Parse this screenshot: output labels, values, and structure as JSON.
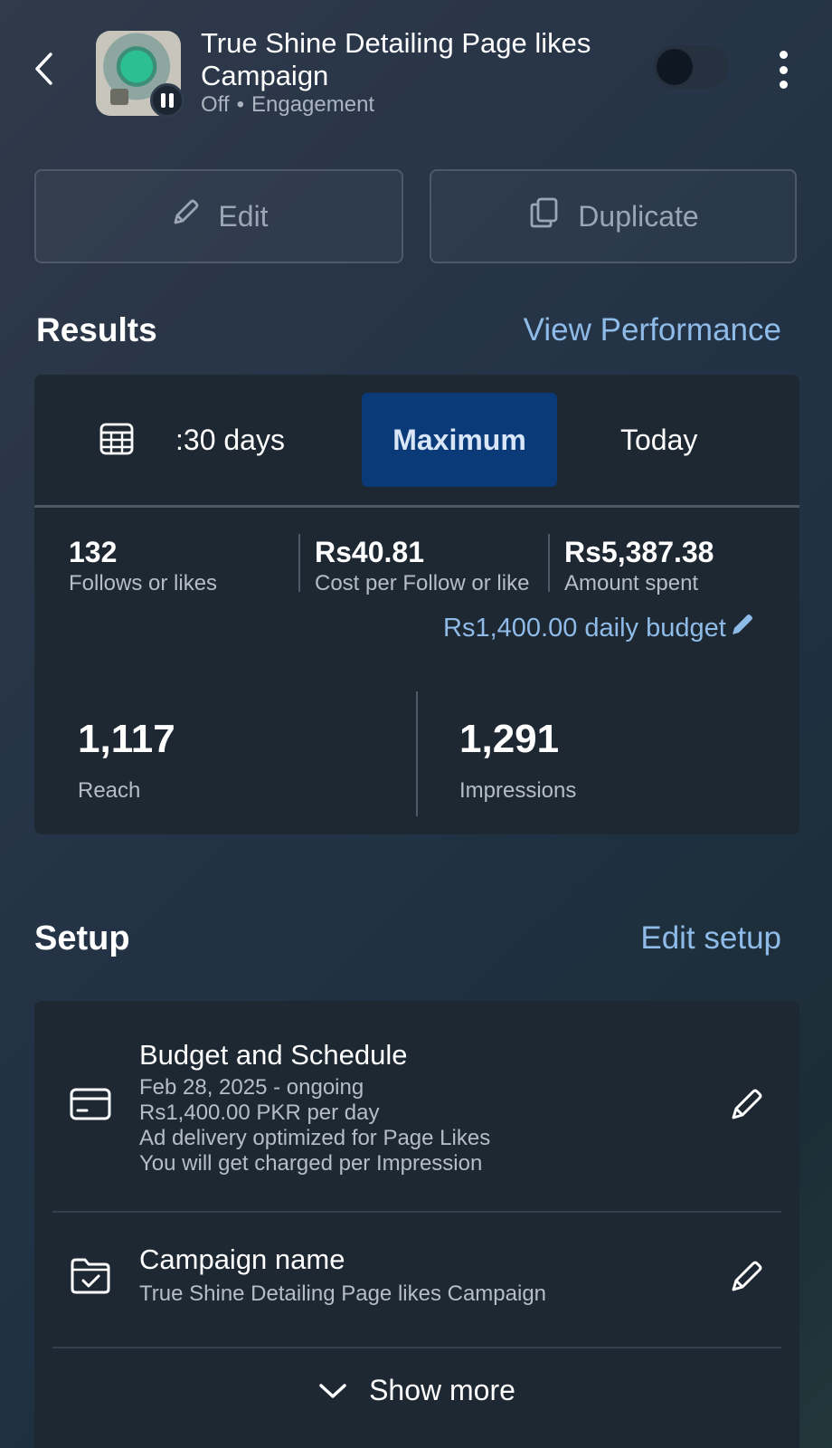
{
  "header": {
    "title": "True Shine Detailing Page likes Campaign",
    "status": "Off",
    "separator": "•",
    "objective": "Engagement",
    "toggle_on": false
  },
  "actions": {
    "edit_label": "Edit",
    "duplicate_label": "Duplicate"
  },
  "results": {
    "heading": "Results",
    "view_link": "View Performance",
    "ranges": {
      "days_label": ":30 days",
      "maximum_label": "Maximum",
      "today_label": "Today",
      "selected": "Maximum"
    },
    "metrics": [
      {
        "value": "132",
        "label": "Follows or likes"
      },
      {
        "value": "Rs40.81",
        "label": "Cost per Follow or like"
      },
      {
        "value": "Rs5,387.38",
        "label": "Amount spent"
      }
    ],
    "daily_budget": "Rs1,400.00 daily budget",
    "reach": {
      "value": "1,117",
      "label": "Reach"
    },
    "impressions": {
      "value": "1,291",
      "label": "Impressions"
    }
  },
  "setup": {
    "heading": "Setup",
    "edit_link": "Edit setup",
    "budget_schedule": {
      "title": "Budget and Schedule",
      "lines": [
        "Feb 28, 2025 - ongoing",
        "Rs1,400.00 PKR per day",
        "Ad delivery optimized for Page Likes",
        "You will get charged per Impression"
      ]
    },
    "campaign_name": {
      "title": "Campaign name",
      "value": "True Shine Detailing Page likes Campaign"
    },
    "show_more": "Show more"
  },
  "colors": {
    "accent_link": "#8fbbe8",
    "selected_pill": "#0a3a78",
    "card_bg": "#1e2833"
  }
}
